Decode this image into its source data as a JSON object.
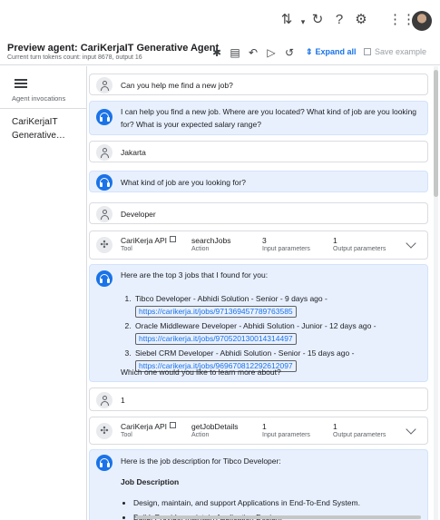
{
  "header": {
    "title": "Preview agent: CariKerjaIT Generative Agent",
    "tokens": "Current turn tokens count: input 8678, output 16",
    "expand_all": "Expand all",
    "save_example": "Save example"
  },
  "sidebar": {
    "section_label": "Agent invocations",
    "item_line1": "CariKerjaIT",
    "item_line2": "Generative…"
  },
  "conversation": {
    "m1": "Can you help me find a new job?",
    "m2": "I can help you find a new job. Where are you located? What kind of job are you looking for? What is your expected salary range?",
    "m3": "Jakarta",
    "m4": "What kind of job are you looking for?",
    "m5": "Developer",
    "tool1": {
      "tool_name": "CariKerja API",
      "tool_label": "Tool",
      "action": "searchJobs",
      "action_label": "Action",
      "input_count": "3",
      "input_label": "Input parameters",
      "output_count": "1",
      "output_label": "Output parameters"
    },
    "m6": {
      "intro": "Here are the top 3 jobs that I found for you:",
      "jobs": [
        {
          "title": "Tibco Developer - Abhidi Solution - Senior - 9 days ago -",
          "link": "https://carikerja.it/jobs/971369457789763585"
        },
        {
          "title": "Oracle Middleware Developer - Abhidi Solution - Junior - 12 days ago -",
          "link": "https://carikerja.it/jobs/970520130014314497"
        },
        {
          "title": "Siebel CRM Developer - Abhidi Solution - Senior - 15 days ago -",
          "link": "https://carikerja.it/jobs/969670812292612097"
        }
      ],
      "followup": "Which one would you like to learn more about?"
    },
    "m7": "1",
    "tool2": {
      "tool_name": "CariKerja API",
      "tool_label": "Tool",
      "action": "getJobDetails",
      "action_label": "Action",
      "input_count": "1",
      "input_label": "Input parameters",
      "output_count": "1",
      "output_label": "Output parameters"
    },
    "m8": {
      "intro": "Here is the job description for Tibco Developer:",
      "heading": "Job Description",
      "bullets": [
        "Design, maintain, and support Applications in End-To-End System.",
        "Build, Provide, maintain Application Design."
      ]
    }
  },
  "colors": {
    "accent": "#1a73e8",
    "agent_bubble": "#e8f0fe"
  }
}
